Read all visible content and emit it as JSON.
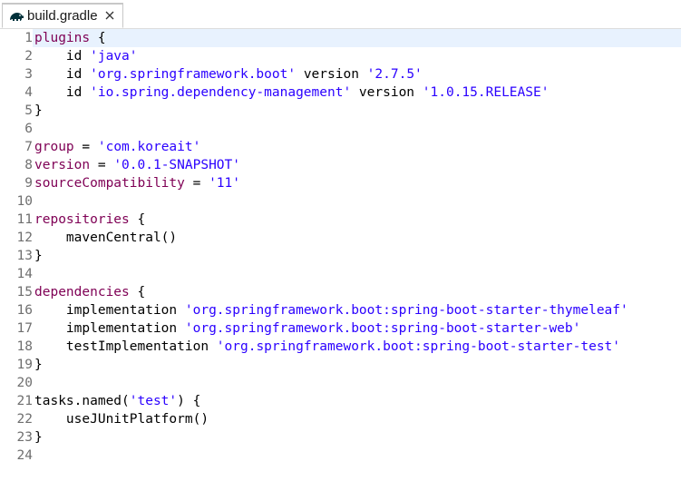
{
  "tab": {
    "title": "build.gradle",
    "icon": "gradle-elephant-icon",
    "close_icon": "close-icon"
  },
  "colors": {
    "keyword": "#7f0055",
    "string": "#2a00ff",
    "plain": "#000000",
    "line_number": "#6f6f6f",
    "current_line": "#e8f2fe"
  },
  "editor": {
    "lines": [
      {
        "n": "1",
        "tokens": [
          {
            "t": "plugins",
            "k": "kw"
          },
          {
            "t": " {",
            "k": "plain"
          }
        ]
      },
      {
        "n": "2",
        "tokens": [
          {
            "t": "    id ",
            "k": "plain"
          },
          {
            "t": "'java'",
            "k": "str"
          }
        ]
      },
      {
        "n": "3",
        "tokens": [
          {
            "t": "    id ",
            "k": "plain"
          },
          {
            "t": "'org.springframework.boot'",
            "k": "str"
          },
          {
            "t": " version ",
            "k": "plain"
          },
          {
            "t": "'2.7.5'",
            "k": "str"
          }
        ]
      },
      {
        "n": "4",
        "tokens": [
          {
            "t": "    id ",
            "k": "plain"
          },
          {
            "t": "'io.spring.dependency-management'",
            "k": "str"
          },
          {
            "t": " version ",
            "k": "plain"
          },
          {
            "t": "'1.0.15.RELEASE'",
            "k": "str"
          }
        ]
      },
      {
        "n": "5",
        "tokens": [
          {
            "t": "}",
            "k": "plain"
          }
        ]
      },
      {
        "n": "6",
        "tokens": []
      },
      {
        "n": "7",
        "tokens": [
          {
            "t": "group",
            "k": "kw"
          },
          {
            "t": " = ",
            "k": "plain"
          },
          {
            "t": "'com.koreait'",
            "k": "str"
          }
        ]
      },
      {
        "n": "8",
        "tokens": [
          {
            "t": "version",
            "k": "kw"
          },
          {
            "t": " = ",
            "k": "plain"
          },
          {
            "t": "'0.0.1-SNAPSHOT'",
            "k": "str"
          }
        ]
      },
      {
        "n": "9",
        "tokens": [
          {
            "t": "sourceCompatibility",
            "k": "kw"
          },
          {
            "t": " = ",
            "k": "plain"
          },
          {
            "t": "'11'",
            "k": "str"
          }
        ]
      },
      {
        "n": "10",
        "tokens": []
      },
      {
        "n": "11",
        "tokens": [
          {
            "t": "repositories",
            "k": "kw"
          },
          {
            "t": " {",
            "k": "plain"
          }
        ]
      },
      {
        "n": "12",
        "tokens": [
          {
            "t": "    mavenCentral()",
            "k": "plain"
          }
        ]
      },
      {
        "n": "13",
        "tokens": [
          {
            "t": "}",
            "k": "plain"
          }
        ]
      },
      {
        "n": "14",
        "tokens": []
      },
      {
        "n": "15",
        "tokens": [
          {
            "t": "dependencies",
            "k": "kw"
          },
          {
            "t": " {",
            "k": "plain"
          }
        ]
      },
      {
        "n": "16",
        "tokens": [
          {
            "t": "    implementation ",
            "k": "plain"
          },
          {
            "t": "'org.springframework.boot:spring-boot-starter-thymeleaf'",
            "k": "str"
          }
        ]
      },
      {
        "n": "17",
        "tokens": [
          {
            "t": "    implementation ",
            "k": "plain"
          },
          {
            "t": "'org.springframework.boot:spring-boot-starter-web'",
            "k": "str"
          }
        ]
      },
      {
        "n": "18",
        "tokens": [
          {
            "t": "    testImplementation ",
            "k": "plain"
          },
          {
            "t": "'org.springframework.boot:spring-boot-starter-test'",
            "k": "str"
          }
        ]
      },
      {
        "n": "19",
        "tokens": [
          {
            "t": "}",
            "k": "plain"
          }
        ]
      },
      {
        "n": "20",
        "tokens": []
      },
      {
        "n": "21",
        "tokens": [
          {
            "t": "tasks.named(",
            "k": "plain"
          },
          {
            "t": "'test'",
            "k": "str"
          },
          {
            "t": ") {",
            "k": "plain"
          }
        ]
      },
      {
        "n": "22",
        "tokens": [
          {
            "t": "    useJUnitPlatform()",
            "k": "plain"
          }
        ]
      },
      {
        "n": "23",
        "tokens": [
          {
            "t": "}",
            "k": "plain"
          }
        ]
      },
      {
        "n": "24",
        "tokens": []
      }
    ]
  }
}
